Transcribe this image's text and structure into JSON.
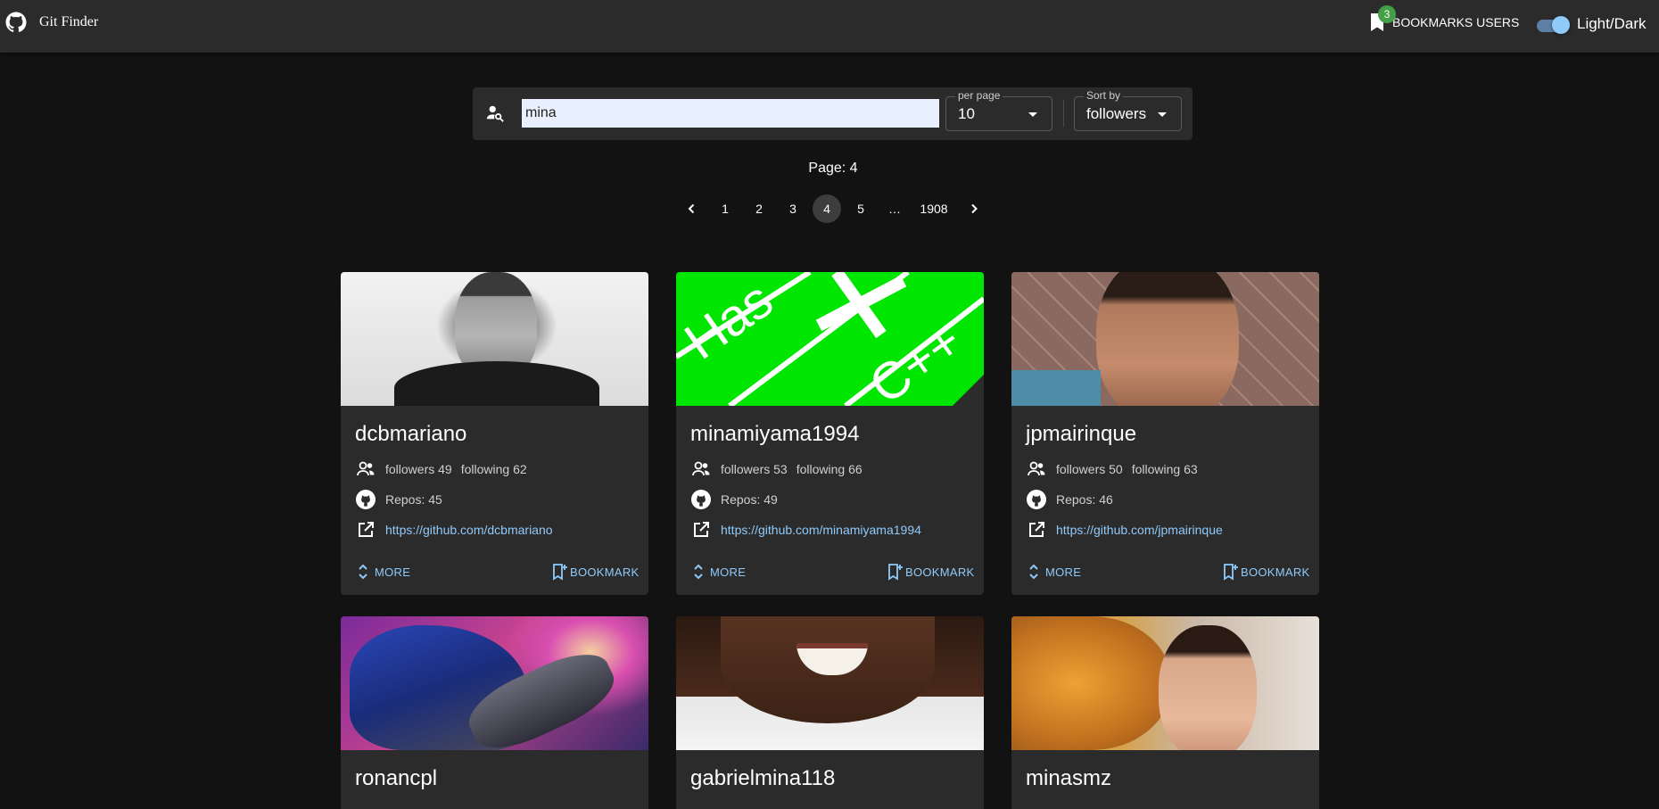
{
  "app": {
    "title": "Git Finder",
    "bookmarks_label": "BOOKMARKS USERS",
    "bookmarks_count": "3",
    "theme_label": "Light/Dark",
    "theme_toggle_on": true
  },
  "search": {
    "query": "mina",
    "per_page_label": "per page",
    "per_page_value": "10",
    "sort_label": "Sort by",
    "sort_value": "followers"
  },
  "pagination": {
    "page_text": "Page: 4",
    "pages": [
      "1",
      "2",
      "3",
      "4",
      "5",
      "…",
      "1908"
    ],
    "current": "4"
  },
  "cards": [
    {
      "name": "dcbmariano",
      "followers": "followers 49",
      "following": "following 62",
      "repos": "Repos: 45",
      "url": "https://github.com/dcbmariano",
      "more": "MORE",
      "bookmark": "BOOKMARK"
    },
    {
      "name": "minamiyama1994",
      "followers": "followers 53",
      "following": "following 66",
      "repos": "Repos: 49",
      "url": "https://github.com/minamiyama1994",
      "more": "MORE",
      "bookmark": "BOOKMARK"
    },
    {
      "name": "jpmairinque",
      "followers": "followers 50",
      "following": "following 63",
      "repos": "Repos: 46",
      "url": "https://github.com/jpmairinque",
      "more": "MORE",
      "bookmark": "BOOKMARK"
    },
    {
      "name": "ronancpl"
    },
    {
      "name": "gabrielmina118"
    },
    {
      "name": "minasmz"
    }
  ],
  "colors": {
    "background": "#121212",
    "surface": "#2b2b2b",
    "accent": "#90caf9",
    "badge": "#43a047",
    "media_green": "#00e600"
  }
}
